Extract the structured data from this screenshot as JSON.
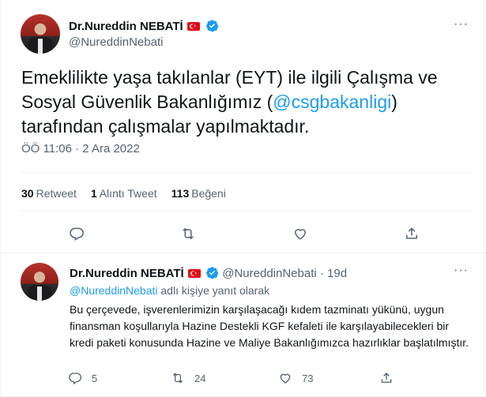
{
  "main_tweet": {
    "author_name": "Dr.Nureddin NEBATİ",
    "handle": "@NureddinNebati",
    "text_before": "Emeklilikte yaşa takılanlar (EYT) ile ilgili Çalışma ve Sosyal Güvenlik Bakanlığımız (",
    "mention": "@csgbakanligi",
    "text_after": ") tarafından çalışmalar yapılmaktadır.",
    "timestamp": "ÖÖ 11:06 · 2 Ara 2022",
    "stats": {
      "retweets_count": "30",
      "retweets_label": "Retweet",
      "quotes_count": "1",
      "quotes_label": "Alıntı Tweet",
      "likes_count": "113",
      "likes_label": "Beğeni"
    }
  },
  "reply_tweet": {
    "author_name": "Dr.Nureddin NEBATİ",
    "handle": "@NureddinNebati",
    "age": "· 19d",
    "replying_to_mention": "@NureddinNebati",
    "replying_to_suffix": " adlı kişiye yanıt olarak",
    "text": "Bu çerçevede, işverenlerimizin karşılaşacağı kıdem tazminatı yükünü, uygun finansman koşullarıyla Hazine Destekli KGF kefaleti ile karşılayabilecekleri bir kredi paketi konusunda Hazine ve Maliye Bakanlığımızca hazırlıklar başlatılmıştır.",
    "counts": {
      "replies": "5",
      "retweets": "24",
      "likes": "73"
    }
  },
  "icons": {
    "more": "more-dots-icon",
    "verified": "verified-badge-icon",
    "flag": "turkey-flag-icon",
    "reply": "reply-bubble-icon",
    "retweet": "retweet-arrows-icon",
    "like": "heart-icon",
    "share": "share-upload-icon"
  },
  "colors": {
    "accent": "#1d9bf0",
    "muted": "#536471",
    "text": "#0f1419",
    "flag": "#e30a17"
  },
  "more_glyph": "···"
}
